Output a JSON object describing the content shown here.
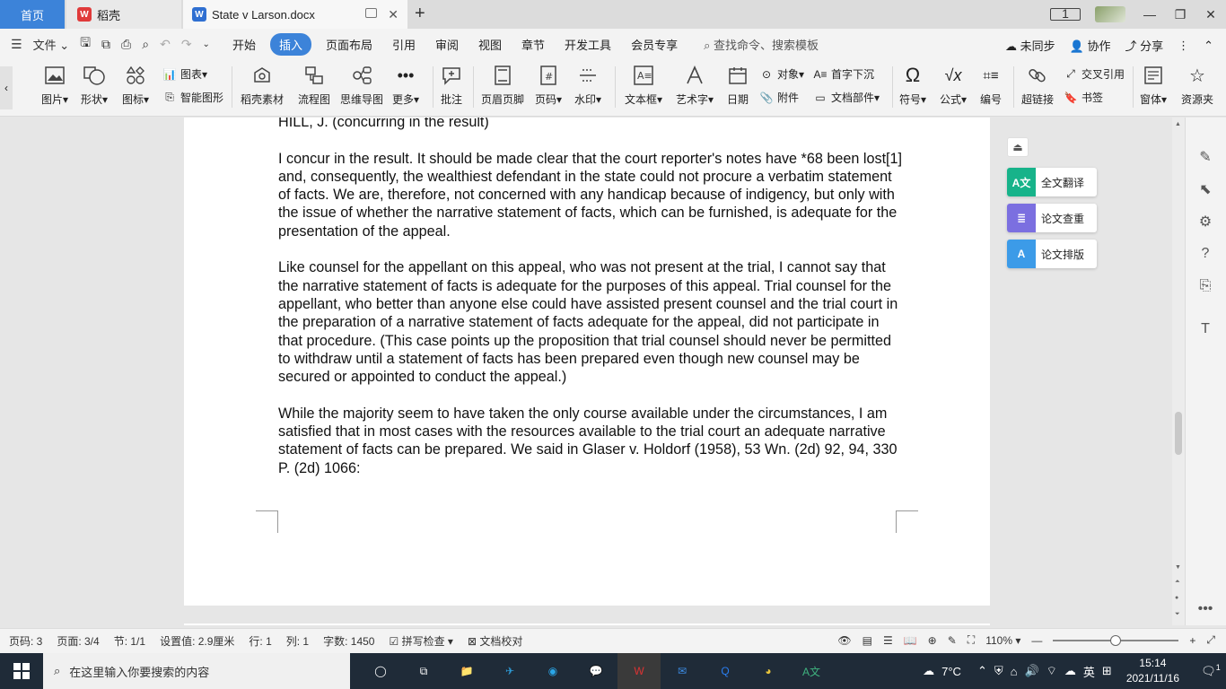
{
  "tabs": {
    "home": "首页",
    "daoke": "稻壳",
    "doc": "State v Larson.docx"
  },
  "menu": {
    "file": "文件",
    "items": [
      "开始",
      "插入",
      "页面布局",
      "引用",
      "审阅",
      "视图",
      "章节",
      "开发工具",
      "会员专享"
    ],
    "active_index": 1,
    "search_placeholder": "查找命令、搜索模板",
    "unsynced": "未同步",
    "collab": "协作",
    "share": "分享"
  },
  "ribbon": {
    "picture": "图片",
    "shape": "形状",
    "icon": "图标",
    "chart": "图表",
    "smart_shape": "智能图形",
    "daoke_material": "稻壳素材",
    "flowchart": "流程图",
    "mindmap": "思维导图",
    "more": "更多",
    "comment": "批注",
    "header_footer": "页眉页脚",
    "page_number": "页码",
    "watermark": "水印",
    "textbox": "文本框",
    "wordart": "艺术字",
    "date": "日期",
    "object": "对象",
    "attachment": "附件",
    "dropcap": "首字下沉",
    "doc_parts": "文档部件",
    "symbol": "符号",
    "formula": "公式",
    "numbering": "编号",
    "hyperlink": "超链接",
    "cross_ref": "交叉引用",
    "bookmark": "书签",
    "window": "窗体",
    "resources": "资源夹"
  },
  "document": {
    "heading": "HILL, J. (concurring in the result)",
    "paragraphs": [
      "I concur in the result. It should be made clear that the court reporter's notes have *68 been lost[1] and, consequently, the wealthiest defendant in the state could not procure a verbatim statement of facts. We are, therefore, not concerned with any handicap because of indigency, but only with the issue of whether the narrative statement of facts, which can be furnished, is adequate for the presentation of the appeal.",
      "Like counsel for the appellant on this appeal, who was not present at the trial, I cannot say that the narrative statement of facts is adequate for the purposes of this appeal. Trial counsel for the appellant, who better than anyone else could have assisted present counsel and the trial court in the preparation of a narrative statement of facts adequate for the appeal, did not participate in that procedure. (This case points up the proposition that trial counsel should never be permitted to withdraw until a statement of facts has been prepared even though new counsel may be secured or appointed to conduct the appeal.)",
      "While the majority seem to have taken the only course available under the circumstances, I am satisfied that in most cases with the resources available to the trial court an adequate narrative statement of facts can be prepared. We said in Glaser v. Holdorf (1958), 53 Wn. (2d) 92, 94, 330 P. (2d) 1066:"
    ]
  },
  "float_buttons": {
    "translate": "全文翻译",
    "plagiarism": "论文查重",
    "layout": "论文排版"
  },
  "status": {
    "page_code": "页码: 3",
    "pages": "页面: 3/4",
    "section": "节: 1/1",
    "setting": "设置值: 2.9厘米",
    "row": "行: 1",
    "col": "列: 1",
    "words": "字数: 1450",
    "spellcheck": "拼写检查",
    "proofread": "文档校对",
    "zoom": "110%"
  },
  "taskbar": {
    "search_placeholder": "在这里输入你要搜索的内容",
    "weather": "7°C",
    "ime": "英",
    "time": "15:14",
    "date": "2021/11/16",
    "notifications": "1"
  },
  "colors": {
    "accent": "#3c83d9",
    "taskbar": "#1f2b38",
    "translate": "#17b38a",
    "plagiarism": "#7b6fe0",
    "layout": "#3c9be8"
  }
}
